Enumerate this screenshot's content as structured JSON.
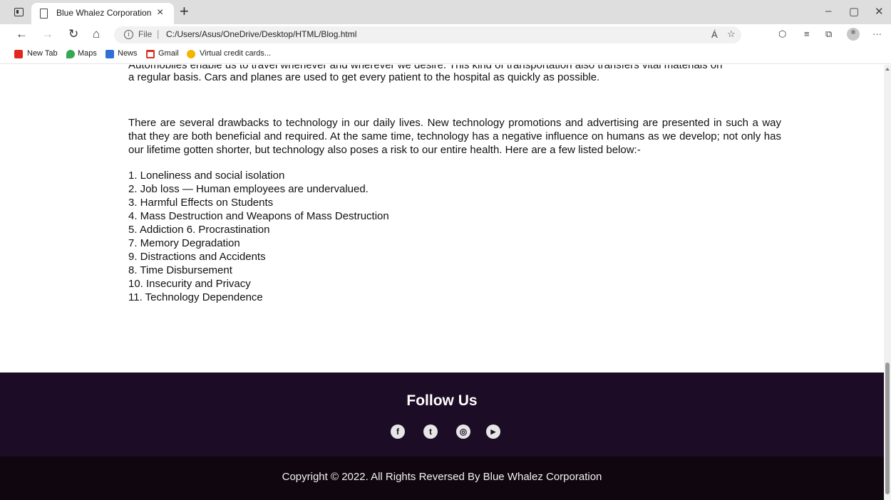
{
  "browser": {
    "tab_title": "Blue Whalez Corporation",
    "tab_close": "×",
    "new_tab": "+",
    "window": {
      "minimize": "–",
      "maximize": "▢",
      "close": "✕"
    },
    "address": {
      "info": "i",
      "scheme": "File",
      "separator": "|",
      "url": "C:/Users/Asus/OneDrive/Desktop/HTML/Blog.html"
    },
    "nav": {
      "back": "←",
      "forward": "→",
      "reload": "↻",
      "home": "⌂"
    },
    "toolbar_icons": {
      "read_aloud": "Á",
      "favorite": "☆",
      "extensions": "⬡",
      "favorites": "≡",
      "collections": "⧉",
      "more": "···"
    },
    "bookmarks": [
      {
        "label": "New Tab",
        "color": "#e0281f"
      },
      {
        "label": "Maps",
        "color": "#34a853"
      },
      {
        "label": "News",
        "color": "#2f6fd6"
      },
      {
        "label": "Gmail",
        "color": "#d93025"
      },
      {
        "label": "Virtual credit cards...",
        "color": "#f4b400"
      }
    ]
  },
  "article": {
    "cut_line": "Automobiles enable us to travel whenever and wherever we desire. This kind of transportation also transfers vital materials on",
    "paragraph_tail": "a regular basis. Cars and planes are used to get every patient to the hospital as quickly as possible.",
    "drawbacks_intro": "There are several drawbacks to technology in our daily lives. New technology promotions and advertising are presented in such a way that they are both beneficial and required. At the same time, technology has a negative influence on humans as we develop; not only has our lifetime gotten shorter, but technology also poses a risk to our entire health. Here are a few listed below:-",
    "drawbacks": [
      "1. Loneliness and social isolation",
      "2. Job loss — Human employees are undervalued.",
      "3. Harmful Effects on Students",
      "4. Mass Destruction and Weapons of Mass Destruction",
      "5. Addiction 6. Procrastination",
      "7. Memory Degradation",
      "9. Distractions and Accidents",
      "8. Time Disbursement",
      "10. Insecurity and Privacy",
      "11. Technology Dependence"
    ]
  },
  "footer": {
    "follow_title": "Follow Us",
    "social_icons": [
      {
        "name": "facebook-icon",
        "glyph": "f"
      },
      {
        "name": "twitter-icon",
        "glyph": "t"
      },
      {
        "name": "instagram-icon",
        "glyph": "◎"
      },
      {
        "name": "youtube-icon",
        "glyph": "▶"
      }
    ],
    "copyright": "Copyright © 2022. All Rights Reversed By Blue Whalez Corporation",
    "colors": {
      "follow_bg": "#1d0c25",
      "copyright_bg": "#10060f"
    }
  }
}
